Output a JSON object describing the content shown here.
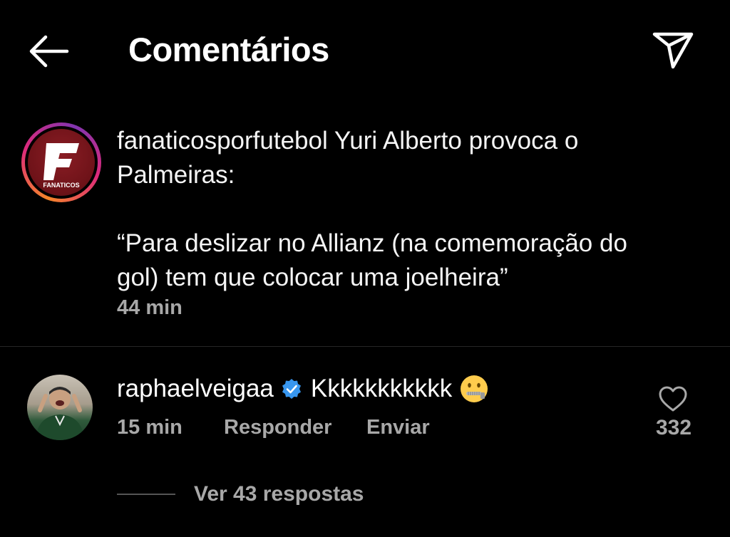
{
  "header": {
    "title": "Comentários",
    "back_icon": "arrow-left-icon",
    "share_icon": "send-paper-plane-icon"
  },
  "caption": {
    "avatar_logo_letter": "F",
    "avatar_logo_text": "FANATICOS",
    "username": "fanaticosporfutebol",
    "text_line1": "Yuri Alberto provoca o Palmeiras:",
    "quote": "“Para deslizar no Allianz (na comemoração do gol) tem que colocar uma joelheira”",
    "time": "44 min"
  },
  "comment": {
    "username": "raphaelveigaa",
    "verified": true,
    "text": "Kkkkkkkkkkk",
    "emoji": "zipper-mouth-face",
    "time": "15 min",
    "reply_label": "Responder",
    "send_label": "Enviar",
    "like_count": "332"
  },
  "replies": {
    "label": "Ver 43 respostas"
  },
  "colors": {
    "background": "#000000",
    "text": "#ffffff",
    "secondary": "#a8a8a8",
    "verified": "#3897f0",
    "divider": "#262626"
  }
}
